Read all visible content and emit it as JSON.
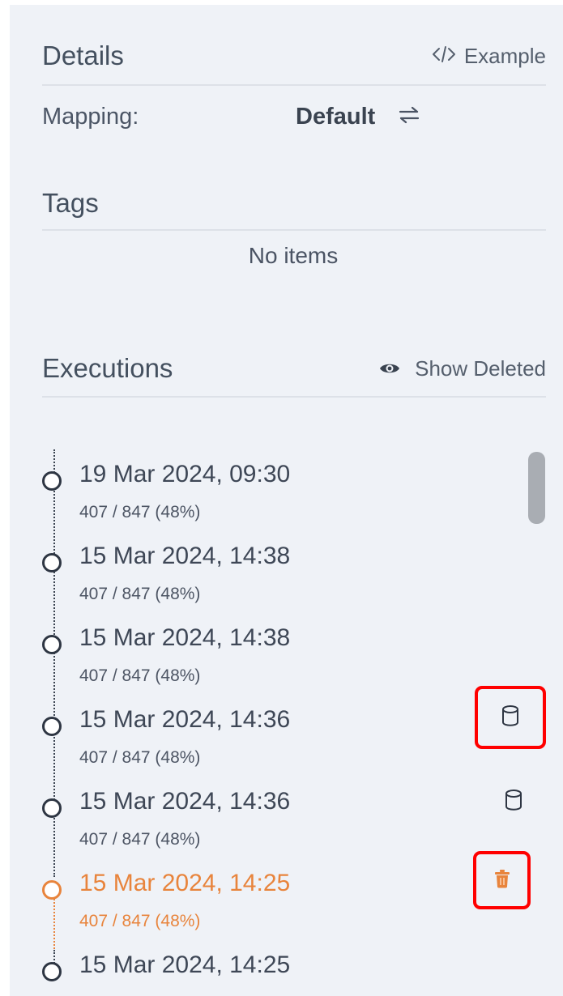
{
  "details": {
    "title": "Details",
    "example_label": "Example",
    "example_icon": "code-icon",
    "mapping_label": "Mapping:",
    "mapping_value": "Default",
    "mapping_icon": "swap-arrows-icon"
  },
  "tags": {
    "title": "Tags",
    "empty_text": "No items"
  },
  "executions": {
    "title": "Executions",
    "show_deleted_label": "Show Deleted",
    "show_deleted_icon": "eye-icon",
    "items": [
      {
        "date": "19 Mar 2024, 09:30",
        "stats": "407 / 847 (48%)"
      },
      {
        "date": "15 Mar 2024, 14:38",
        "stats": "407 / 847 (48%)"
      },
      {
        "date": "15 Mar 2024, 14:38",
        "stats": "407 / 847 (48%)"
      },
      {
        "date": "15 Mar 2024, 14:36",
        "stats": "407 / 847 (48%)",
        "action_icon": "database-icon",
        "highlighted": true
      },
      {
        "date": "15 Mar 2024, 14:36",
        "stats": "407 / 847 (48%)",
        "action_icon": "database-icon"
      },
      {
        "date": "15 Mar 2024, 14:25",
        "stats": "407 / 847 (48%)",
        "action_icon": "trash-icon",
        "highlighted": true,
        "active": true
      },
      {
        "date": "15 Mar 2024, 14:25",
        "stats": ""
      }
    ]
  },
  "colors": {
    "accent": "#e8843c",
    "highlight_border": "#ff0000",
    "panel_background": "#eff2f7"
  }
}
